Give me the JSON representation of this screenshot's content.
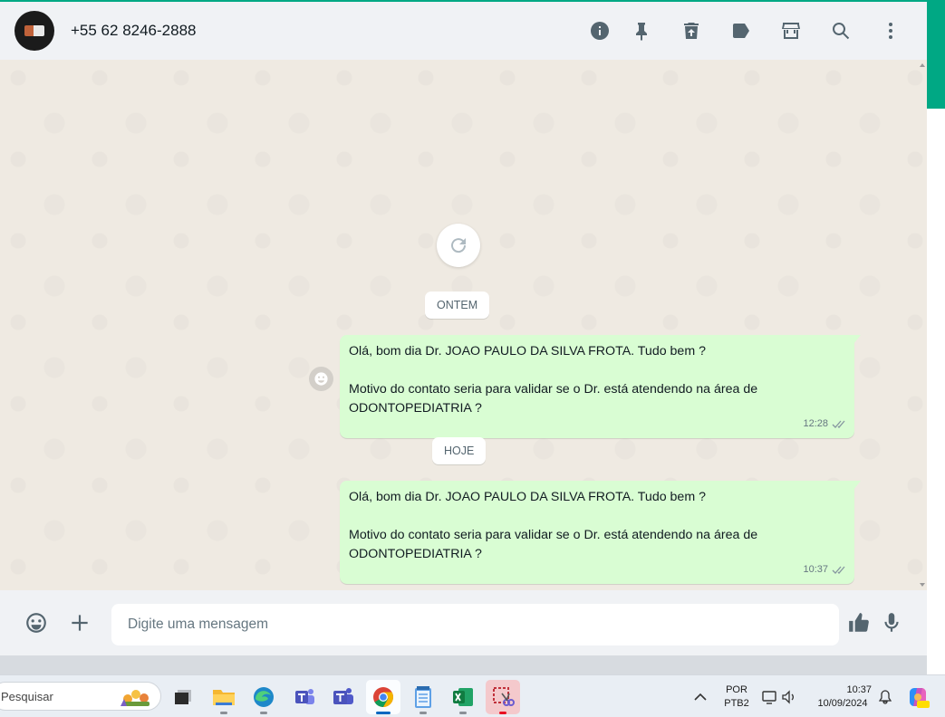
{
  "header": {
    "contact_name": "+55 62 8246-2888",
    "icons": [
      "info-icon",
      "pin-icon",
      "delete-icon",
      "label-icon",
      "store-icon",
      "search-icon",
      "menu-icon"
    ]
  },
  "chat": {
    "date_separators": [
      "ONTEM",
      "HOJE"
    ],
    "messages": [
      {
        "text": "Olá, bom dia Dr. JOAO PAULO DA SILVA FROTA. Tudo bem ?\n\nMotivo do contato seria para validar se o Dr. está atendendo na área de ODONTOPEDIATRIA ?",
        "time": "12:28",
        "status": "delivered"
      },
      {
        "text": "Olá, bom dia Dr. JOAO PAULO DA SILVA FROTA. Tudo bem ?\n\nMotivo do contato seria para validar se o Dr. está atendendo na área de ODONTOPEDIATRIA ?",
        "time": "10:37",
        "status": "delivered"
      }
    ]
  },
  "composer": {
    "placeholder": "Digite uma mensagem"
  },
  "taskbar": {
    "search_label": "Pesquisar",
    "language": "POR",
    "layout": "PTB2",
    "time": "10:37",
    "date": "10/09/2024"
  },
  "colors": {
    "accent": "#00a884",
    "bubble_out": "#d9fdd3",
    "chat_bg": "#efeae2",
    "panel_bg": "#f0f2f5",
    "tick": "#8696a0"
  }
}
